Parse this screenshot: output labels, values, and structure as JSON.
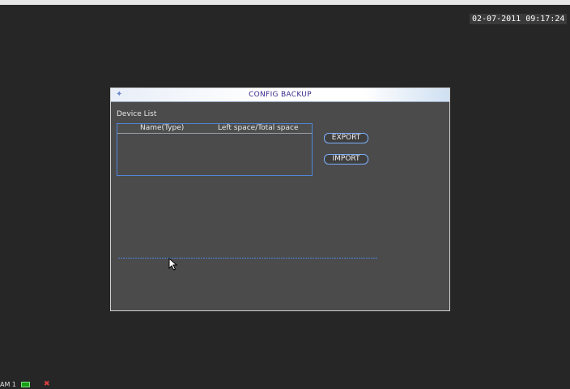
{
  "screen": {
    "timestamp": "02-07-2011 09:17:24"
  },
  "dialog": {
    "title": "CONFIG BACKUP",
    "icon": "app-icon",
    "device_list": {
      "label": "Device List",
      "columns": [
        "Name(Type)",
        "Left space/Total space"
      ],
      "rows": []
    },
    "buttons": {
      "export": "EXPORT",
      "import": "IMPORT"
    },
    "progress": 0
  },
  "statusbar": {
    "camera_label": "AM 1",
    "rec_icon": "record-indicator-icon",
    "alarm_icon": "alarm-icon"
  },
  "colors": {
    "background": "#262626",
    "dialog": "#4b4b4b",
    "accent": "#4f86d8",
    "title_text": "#3b2a8a"
  }
}
